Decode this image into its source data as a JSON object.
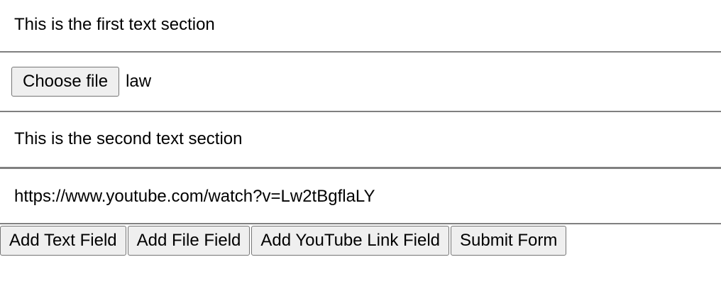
{
  "sections": {
    "first_text": "This is the first text section",
    "file": {
      "button_label": "Choose file",
      "file_name": "law"
    },
    "second_text": "This is the second text section",
    "youtube_link": "https://www.youtube.com/watch?v=Lw2tBgflaLY"
  },
  "actions": {
    "add_text_field": "Add Text Field",
    "add_file_field": "Add File Field",
    "add_youtube_link_field": "Add YouTube Link Field",
    "submit_form": "Submit Form"
  }
}
